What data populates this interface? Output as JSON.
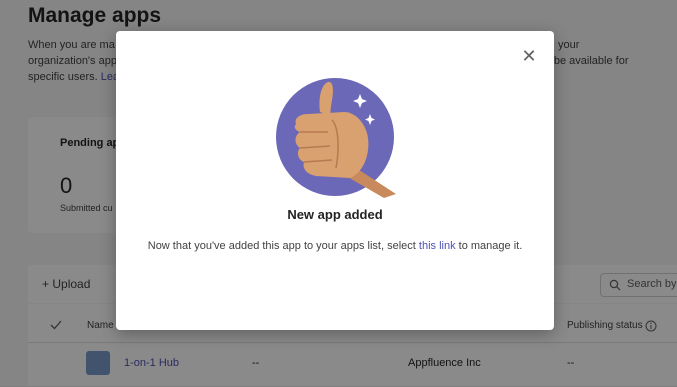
{
  "page": {
    "title": "Manage apps",
    "desc_line1": "When you are ma",
    "desc_line1_right": "your",
    "desc_line2": "organization's app",
    "desc_line2_right": "vill be available for",
    "desc_line3": "specific users.",
    "desc_link": "Lea"
  },
  "pending_card": {
    "title": "Pending ap",
    "count": "0",
    "subtitle": "Submitted cu"
  },
  "toolbar": {
    "upload_label": "Upload",
    "search_placeholder": "Search by"
  },
  "table": {
    "headers": {
      "name": "Name",
      "publishing_status": "Publishing status"
    },
    "rows": [
      {
        "name": "1-on-1 Hub",
        "col2": "--",
        "publisher": "Appfluence Inc",
        "status": "--"
      }
    ]
  },
  "modal": {
    "title": "New app added",
    "body_prefix": "Now that you've added this app to your apps list, select",
    "body_link": "this link",
    "body_suffix": "to manage it."
  },
  "colors": {
    "illustration_circle": "#6c68b8",
    "link": "#4f52b2",
    "skin": "#c88a5c"
  }
}
